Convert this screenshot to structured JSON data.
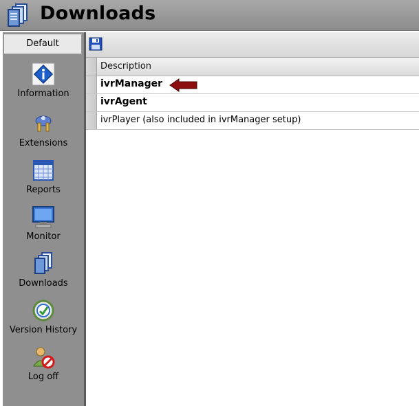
{
  "window": {
    "title": "Downloads",
    "title_icon": "downloads-icon"
  },
  "sidebar": {
    "tab_label": "Default",
    "items": [
      {
        "label": "Information",
        "icon": "information-icon"
      },
      {
        "label": "Extensions",
        "icon": "extensions-icon"
      },
      {
        "label": "Reports",
        "icon": "reports-icon"
      },
      {
        "label": "Monitor",
        "icon": "monitor-icon"
      },
      {
        "label": "Downloads",
        "icon": "downloads-icon"
      },
      {
        "label": "Version History",
        "icon": "version-history-icon"
      },
      {
        "label": "Log off",
        "icon": "log-off-icon"
      }
    ]
  },
  "toolbar": {
    "save_icon": "save-icon"
  },
  "grid": {
    "column_header": "Description",
    "rows": [
      {
        "text": "ivrManager",
        "bold": true,
        "highlighted_with_arrow": true
      },
      {
        "text": "ivrAgent",
        "bold": true
      },
      {
        "text": "ivrPlayer (also included in ivrManager setup)",
        "bold": false
      }
    ]
  },
  "colors": {
    "arrow": "#8b0f0f",
    "sidebar_bg": "#8f8f8f",
    "titlebar_bg": "#9a9a9a"
  }
}
